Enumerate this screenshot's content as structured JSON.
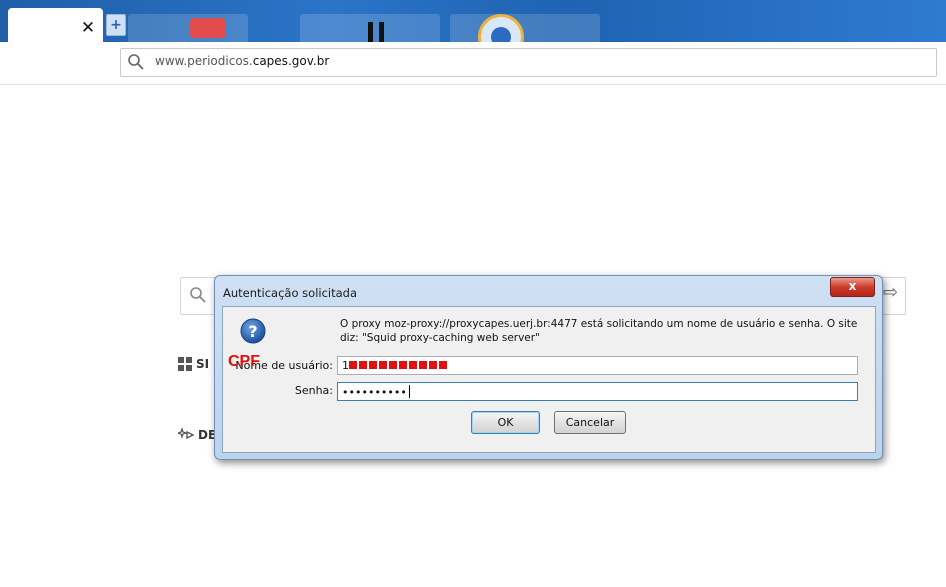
{
  "browser": {
    "tab_close_glyph": "✕",
    "new_tab_glyph": "+",
    "url": {
      "prefix": "www.periodicos.",
      "host": "capes.gov.br"
    }
  },
  "page": {
    "arrow_glyph": "⇨",
    "nav": [
      {
        "label": "SI",
        "icon": "grid-icon"
      },
      {
        "label": "DE",
        "icon": "sparkle-icon"
      }
    ]
  },
  "dialog": {
    "title": "Autenticação solicitada",
    "close_glyph": "x",
    "message": "O proxy moz-proxy://proxycapes.uerj.br:4477 está solicitando um nome de usuário e senha. O site diz: \"Squid proxy-caching web server\"",
    "username_label": "Nome de usuário:",
    "username_value_prefix": "1",
    "username_annotation": "CPF",
    "password_label": "Senha:",
    "password_value": "••••••••••",
    "ok_label": "OK",
    "cancel_label": "Cancelar"
  },
  "colors": {
    "titlebar_blue": "#2b74c7",
    "dialog_frame": "#bcd3ec",
    "close_red": "#cf3d2b",
    "annotation_red": "#e01010"
  }
}
